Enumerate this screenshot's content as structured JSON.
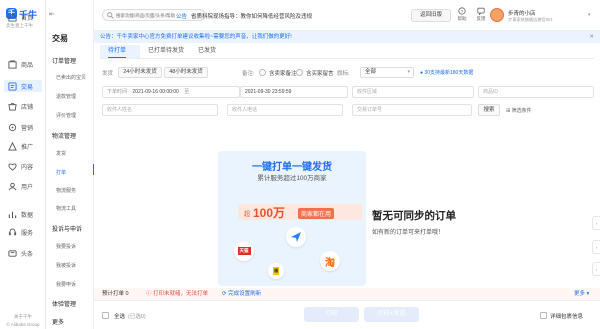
{
  "brand": {
    "logo_char": "千",
    "name": "千牛",
    "tagline": "卖生意上千牛"
  },
  "nav_main": [
    {
      "label": "首页",
      "icon": "home-icon"
    },
    {
      "label": "商品",
      "icon": "goods-icon"
    },
    {
      "label": "交易",
      "icon": "trade-icon",
      "active": true
    },
    {
      "label": "店铺",
      "icon": "shop-icon"
    },
    {
      "label": "营销",
      "icon": "marketing-icon"
    },
    {
      "label": "推广",
      "icon": "promote-icon"
    },
    {
      "label": "内容",
      "icon": "content-icon"
    },
    {
      "label": "用户",
      "icon": "user-icon"
    },
    {
      "label": "数据",
      "icon": "data-icon"
    },
    {
      "label": "服务",
      "icon": "service-icon"
    },
    {
      "label": "头条",
      "icon": "headline-icon"
    }
  ],
  "nav_footer": "关于千牛",
  "nav_footer2": "© Alibaba Group",
  "subnav": {
    "title": "交易",
    "groups": [
      {
        "label": "订单管理",
        "items": [
          "已卖出的宝贝",
          "退款管理",
          "评价管理"
        ]
      },
      {
        "label": "物流管理",
        "items": [
          "发货",
          "打单",
          "物流服务",
          "物流工具"
        ]
      },
      {
        "label": "投诉与申诉",
        "items": [
          "我要投诉",
          "我被投诉",
          "我要申诉"
        ]
      },
      {
        "label": "体验管理",
        "items": []
      },
      {
        "label": "更多",
        "items": []
      }
    ],
    "active_item": "打单"
  },
  "topbar": {
    "search_placeholder": "搜索功能/商品/页面/头条/帮助",
    "notice_tag": "公告",
    "notice_text": "省质科院现场指导：教你如何降低经营风险及违规",
    "back_old": "返回旧版",
    "help": "帮助",
    "feedback": "反馈",
    "store_name": "步青的小店",
    "store_sub": "步青家装旗舰店旗官001"
  },
  "announce": "公告：千牛卖家中心官方免费打单建议收集啦~需要您的声音，让我们做的更好!",
  "tabs": [
    "待打单",
    "已打单待发货",
    "已发货"
  ],
  "filters": {
    "shipping_label": "发货",
    "time_opts": [
      "24小时未发货",
      "48小时未发货"
    ],
    "remark_label": "备注:",
    "seller_remark": "含卖家备注",
    "buyer_msg": "含买家留言",
    "flag_label": "旗标:",
    "flag_value": "全部",
    "guide_link": "● 30支持最新180天数据",
    "order_time_label": "下单时间",
    "start_time": "2021-09-16 00:00:00",
    "end_time": "2021-09-30 23:59:59",
    "to": "至",
    "recv_area": "收件区域",
    "product_id": "商品ID",
    "recv_name": "收件人姓名",
    "recv_phone": "收件人电话",
    "order_no": "交易订单号",
    "search_btn": "搜索",
    "more_filter": "筛选条件"
  },
  "promo": {
    "title": "一键打单一键发货",
    "sub": "累计服务超过100万商家",
    "banner_a": "超",
    "banner_b": "100万",
    "banner_c": "商家都在用",
    "apps": [
      "天猫",
      "淘",
      "福",
      "纸"
    ]
  },
  "empty": {
    "title": "暂无可同步的订单",
    "sub": "如有新的订单可来打单哦！"
  },
  "bar1": {
    "pre": "预计打单 0",
    "warn": "打印未就绪，无法打单",
    "link": "完成设置刷新",
    "more": "更多"
  },
  "bar2": {
    "select_all": "全选",
    "selected": "(已选0)",
    "print": "打印",
    "print_ship": "打印+发货",
    "detail": "详细包裹信息"
  }
}
